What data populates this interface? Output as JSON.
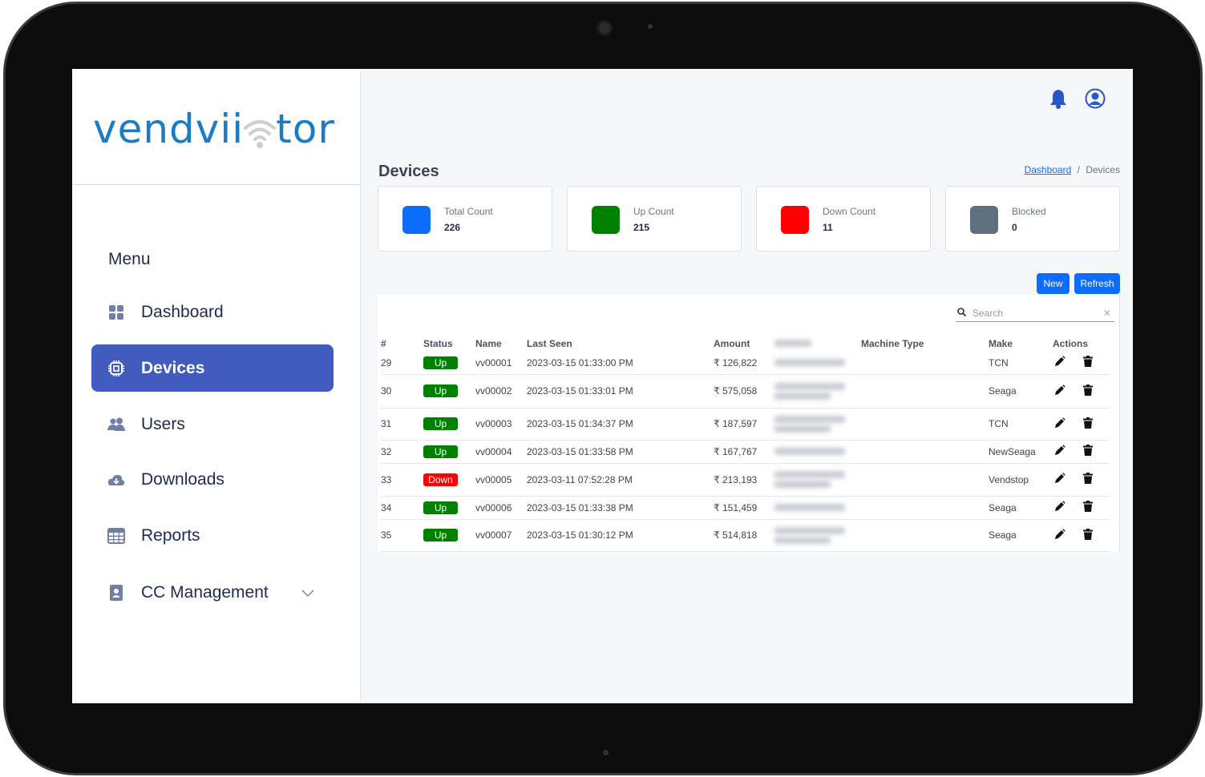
{
  "brand": {
    "logo_text_left": "vendvii",
    "logo_text_right": "tor",
    "colors": {
      "logo": "#1a7cc4",
      "accent": "#425bbf",
      "primary": "#0d6efd"
    }
  },
  "sidebar": {
    "menu_title": "Menu",
    "items": [
      {
        "label": "Dashboard",
        "icon": "grid-icon"
      },
      {
        "label": "Devices",
        "icon": "chip-icon",
        "active": true
      },
      {
        "label": "Users",
        "icon": "users-icon"
      },
      {
        "label": "Downloads",
        "icon": "cloud-download-icon"
      },
      {
        "label": "Reports",
        "icon": "table-icon"
      },
      {
        "label": "CC Management",
        "icon": "id-badge-icon",
        "expandable": true
      }
    ]
  },
  "header": {
    "icons": [
      "bell-icon",
      "user-circle-icon"
    ]
  },
  "page": {
    "title": "Devices",
    "breadcrumb": {
      "link": "Dashboard",
      "separator": "/",
      "current": "Devices"
    }
  },
  "cards": [
    {
      "label": "Total Count",
      "value": "226",
      "color": "#0d6efd"
    },
    {
      "label": "Up Count",
      "value": "215",
      "color": "#008000"
    },
    {
      "label": "Down Count",
      "value": "11",
      "color": "#ff0000"
    },
    {
      "label": "Blocked",
      "value": "0",
      "color": "#5f6e80"
    }
  ],
  "toolbar": {
    "new_label": "New",
    "refresh_label": "Refresh"
  },
  "search": {
    "placeholder": "Search",
    "value": ""
  },
  "table": {
    "columns": [
      "#",
      "Status",
      "Name",
      "Last Seen",
      "Amount",
      "",
      "Machine Type",
      "Make",
      "Actions"
    ],
    "rows": [
      {
        "num": "29",
        "status": "Up",
        "name": "vv00001",
        "last_seen": "2023-03-15 01:33:00 PM",
        "amount": "₹ 126,822",
        "machine_type": "",
        "make": "TCN"
      },
      {
        "num": "30",
        "status": "Up",
        "name": "vv00002",
        "last_seen": "2023-03-15 01:33:01 PM",
        "amount": "₹ 575,058",
        "machine_type": "",
        "make": "Seaga"
      },
      {
        "num": "31",
        "status": "Up",
        "name": "vv00003",
        "last_seen": "2023-03-15 01:34:37 PM",
        "amount": "₹ 187,597",
        "machine_type": "",
        "make": "TCN"
      },
      {
        "num": "32",
        "status": "Up",
        "name": "vv00004",
        "last_seen": "2023-03-15 01:33:58 PM",
        "amount": "₹ 167,767",
        "machine_type": "",
        "make": "NewSeaga"
      },
      {
        "num": "33",
        "status": "Down",
        "name": "vv00005",
        "last_seen": "2023-03-11 07:52:28 PM",
        "amount": "₹ 213,193",
        "machine_type": "",
        "make": "Vendstop"
      },
      {
        "num": "34",
        "status": "Up",
        "name": "vv00006",
        "last_seen": "2023-03-15 01:33:38 PM",
        "amount": "₹ 151,459",
        "machine_type": "",
        "make": "Seaga"
      },
      {
        "num": "35",
        "status": "Up",
        "name": "vv00007",
        "last_seen": "2023-03-15 01:30:12 PM",
        "amount": "₹ 514,818",
        "machine_type": "",
        "make": "Seaga"
      }
    ],
    "status_colors": {
      "Up": "#008000",
      "Down": "#ff0000"
    }
  }
}
